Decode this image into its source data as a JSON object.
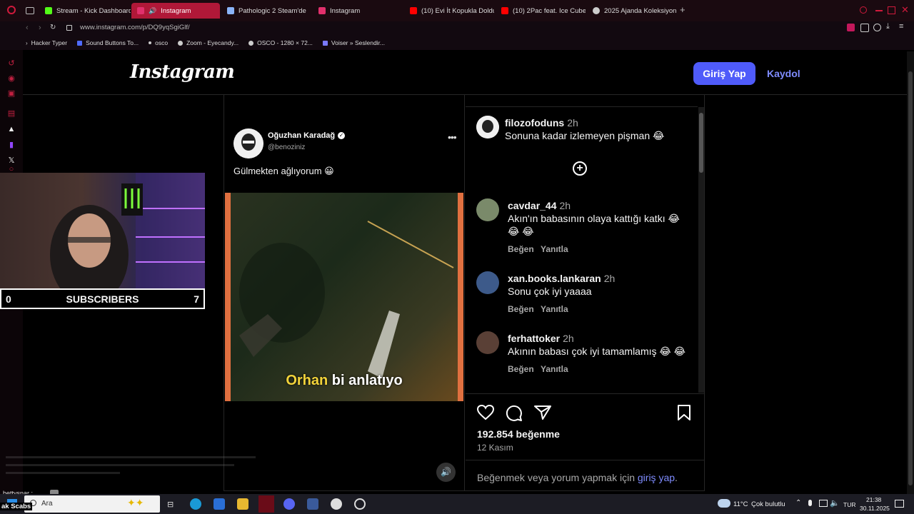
{
  "browser": {
    "tabs": [
      {
        "label": "Stream - Kick Dashboard",
        "color": "#53fc18"
      },
      {
        "label": "Instagram",
        "color": "#e1306c",
        "active": true
      },
      {
        "label": "Pathologic 2 Steam'de",
        "color": "#8ab4f8"
      },
      {
        "label": "Instagram",
        "color": "#e1306c"
      },
      {
        "label": "(10) Evi İt Kopukla Doldur",
        "color": "#ff0000"
      },
      {
        "label": "(10) 2Pac feat. Ice Cube",
        "color": "#ff0000"
      },
      {
        "label": "2025 Ajanda Koleksiyonu",
        "color": "#cccccc"
      }
    ],
    "url": "www.instagram.com/p/DQ9yqSgiGlf/",
    "bookmarks": [
      "Hacker Typer",
      "Sound Buttons To...",
      "osco",
      "Zoom - Eyecandy...",
      "OSCO - 1280 × 72...",
      "Voiser » Seslendir..."
    ]
  },
  "instagram": {
    "logo": "Instagram",
    "login_label": "Giriş Yap",
    "signup_label": "Kaydol"
  },
  "post": {
    "author_name": "Oğuzhan Karadağ",
    "author_handle": "@benoziniz",
    "caption": "Gülmekten ağlıyorum 😀",
    "video_caption_highlight": "Orhan",
    "video_caption_rest": "bi anlatıyo",
    "likes": "192.854 beğenme",
    "date": "12 Kasım",
    "login_prompt_prefix": "Beğenmek veya yorum yapmak için",
    "login_prompt_link": "giriş yap",
    "login_prompt_suffix": "."
  },
  "comments": {
    "top": {
      "user": "filozofoduns",
      "time": "2h",
      "text": "Sonuna kadar izlemeyen pişman 😂"
    },
    "items": [
      {
        "user": "cavdar_44",
        "time": "2h",
        "line1": "Akın'ın babasının olaya kattığı katkı 😂",
        "line2": "😂 😂"
      },
      {
        "user": "xan.books.lankaran",
        "time": "2h",
        "line1": "Sonu çok iyi yaaaa",
        "line2": ""
      },
      {
        "user": "ferhattoker",
        "time": "2h",
        "line1": "Akının babası çok iyi tamamlamış 😂 😂",
        "line2": ""
      }
    ],
    "like_label": "Beğen",
    "reply_label": "Yanıtla"
  },
  "webcam": {
    "left_count": "0",
    "label": "SUBSCRIBERS",
    "right_count": "7"
  },
  "chat": {
    "user": "bettysnar :",
    "ticker": "ak Scabs"
  },
  "taskbar": {
    "search_placeholder": "Ara",
    "weather": "11°C",
    "weather_text": "Çok bulutlu",
    "lang": "TUR",
    "time": "21:38",
    "date": "30.11.2025"
  }
}
